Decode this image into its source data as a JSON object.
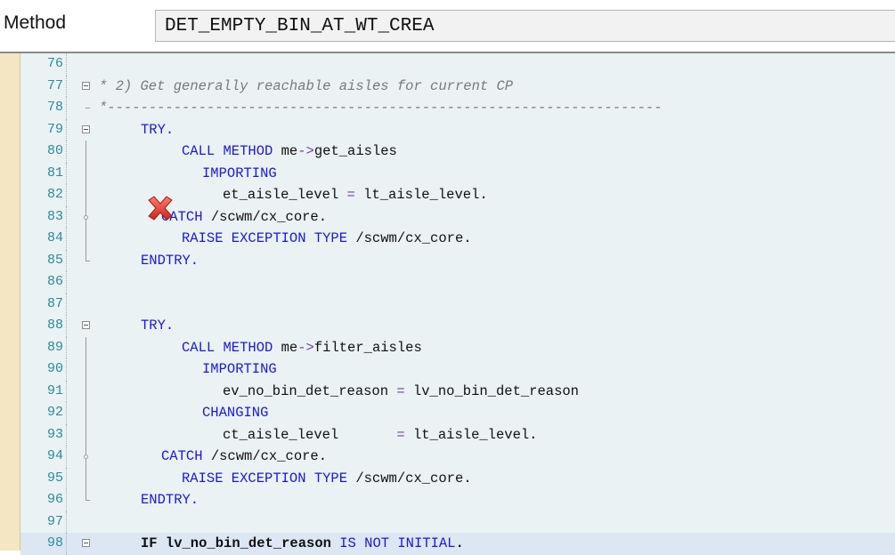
{
  "header": {
    "method_label": "Method",
    "method_value": "DET_EMPTY_BIN_AT_WT_CREA"
  },
  "lines": [
    {
      "no": "76",
      "text": ""
    },
    {
      "no": "77",
      "text": "* 2) Get generally reachable aisles for current CP"
    },
    {
      "no": "78",
      "text": "*-------------------------------------------------------------------"
    },
    {
      "no": "79",
      "text": "TRY."
    },
    {
      "no": "80",
      "text": "CALL METHOD me->get_aisles"
    },
    {
      "no": "81",
      "text": "IMPORTING"
    },
    {
      "no": "82",
      "text": "et_aisle_level = lt_aisle_level."
    },
    {
      "no": "83",
      "text": "CATCH /scwm/cx_core."
    },
    {
      "no": "84",
      "text": "RAISE EXCEPTION TYPE /scwm/cx_core."
    },
    {
      "no": "85",
      "text": "ENDTRY."
    },
    {
      "no": "86",
      "text": ""
    },
    {
      "no": "87",
      "text": ""
    },
    {
      "no": "88",
      "text": "TRY."
    },
    {
      "no": "89",
      "text": "CALL METHOD me->filter_aisles"
    },
    {
      "no": "90",
      "text": "IMPORTING"
    },
    {
      "no": "91",
      "text": "ev_no_bin_det_reason = lv_no_bin_det_reason"
    },
    {
      "no": "92",
      "text": "CHANGING"
    },
    {
      "no": "93",
      "text": "ct_aisle_level       = lt_aisle_level."
    },
    {
      "no": "94",
      "text": "CATCH /scwm/cx_core."
    },
    {
      "no": "95",
      "text": "RAISE EXCEPTION TYPE /scwm/cx_core."
    },
    {
      "no": "96",
      "text": "ENDTRY."
    },
    {
      "no": "97",
      "text": ""
    },
    {
      "no": "98",
      "text": "IF lv_no_bin_det_reason IS NOT INITIAL."
    }
  ],
  "icons": {
    "breakpoint": "red-x-icon"
  },
  "colors": {
    "keyword": "#1a1ad6",
    "comment": "#7a7a7a",
    "line_number": "#2e8a9a",
    "editor_bg": "#eaf2f4",
    "active_line_bg": "#dde6f3"
  }
}
